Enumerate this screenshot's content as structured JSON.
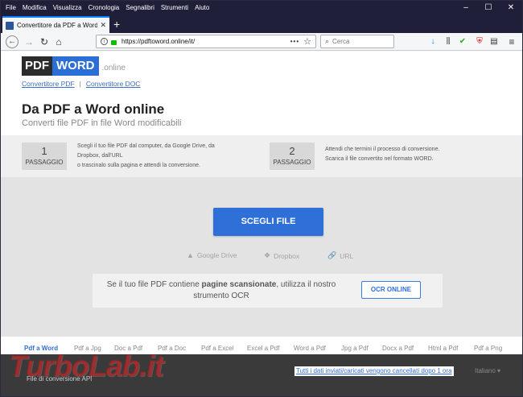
{
  "menu": [
    "File",
    "Modifica",
    "Visualizza",
    "Cronologia",
    "Segnalibri",
    "Strumenti",
    "Aiuto"
  ],
  "window_controls": {
    "minimize": "–",
    "maximize": "☐",
    "close": "✕"
  },
  "tab": {
    "title": "Convertitore da PDF a Word o",
    "close": "✕"
  },
  "newtab": "+",
  "nav": {
    "back_icon": "←",
    "forward_icon": "→",
    "reload_icon": "↻",
    "home_icon": "⌂",
    "url": "https://pdftoword.online/it/",
    "page_actions": "•••",
    "star_icon": "☆",
    "search_placeholder": "Cerca",
    "search_icon": "⌕",
    "download_icon": "↓",
    "library_icon": "⫼",
    "check_icon": "✔",
    "shield_icon": "⛨",
    "sidebar_icon": "▤",
    "menu_icon": "≡"
  },
  "logo": {
    "pdf": "PDF",
    "word": "WORD",
    "online": ".online"
  },
  "toplinks": {
    "link1": "Convertitore PDF",
    "sep": "|",
    "link2": "Convertitore DOC"
  },
  "heading": {
    "title": "Da PDF a Word online",
    "subtitle": "Converti file PDF in file Word modificabili"
  },
  "steps": [
    {
      "num": "1",
      "label": "PASSAGGIO",
      "lines": [
        "Scegli il tuo file PDF dal computer, da Google Drive, da",
        "Dropbox, dall'URL",
        "o trascinalo sulla pagina e attendi la conversione."
      ]
    },
    {
      "num": "2",
      "label": "PASSAGGIO",
      "lines": [
        "Attendi che termini il processo di conversione.",
        "Scarica il file convertito nel formato WORD."
      ]
    }
  ],
  "upload": {
    "choose_button": "SCEGLI FILE",
    "sources": [
      {
        "icon": "▲",
        "label": "Google Drive"
      },
      {
        "icon": "❖",
        "label": "Dropbox"
      },
      {
        "icon": "🔗",
        "label": "URL"
      }
    ]
  },
  "ocr": {
    "text_pre": "Se il tuo file PDF contiene ",
    "text_bold": "pagine scansionate",
    "text_post": ", utilizza il nostro strumento OCR",
    "button": "OCR ONLINE"
  },
  "footer_links": [
    "Pdf a Word",
    "Pdf a Jpg",
    "Doc a Pdf",
    "Pdf a Doc",
    "Pdf a Excel",
    "Excel a Pdf",
    "Word a Pdf",
    "Jpg a Pdf",
    "Docx a Pdf",
    "Html a Pdf",
    "Pdf a Png"
  ],
  "bottom": {
    "api": "File di conversione API",
    "notice": "Tutti i dati inviati/caricati vengono cancellati dopo 1 ora",
    "language": "Italiano ▾"
  },
  "watermark": "TurboLab.it"
}
